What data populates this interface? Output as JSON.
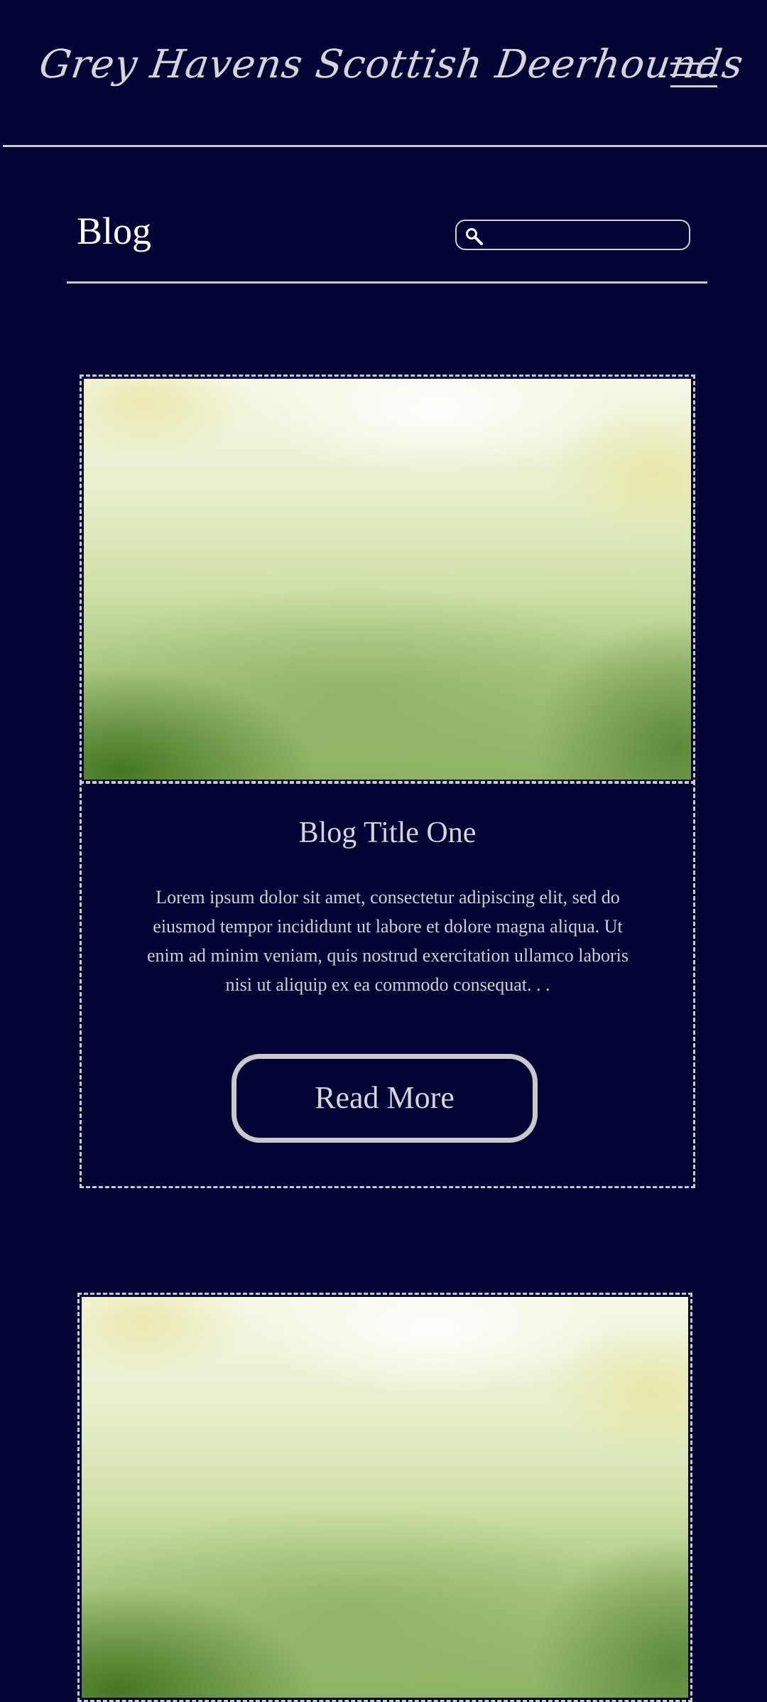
{
  "header": {
    "site_title": "Grey Havens Scottish Deerhounds",
    "menu_icon": "hamburger-menu-icon"
  },
  "blog_bar": {
    "heading": "Blog",
    "search_icon": "search-icon",
    "search_placeholder": "",
    "search_value": ""
  },
  "posts": [
    {
      "title": "Blog Title One",
      "excerpt": "Lorem ipsum dolor sit amet, consectetur adipiscing elit, sed do eiusmod tempor incididunt ut labore et dolore magna aliqua. Ut enim ad minim veniam, quis nostrud exercitation ullamco laboris nisi ut aliquip ex ea commodo consequat. . .",
      "read_more_label": "Read More"
    }
  ],
  "colors": {
    "background": "#010333",
    "text": "#d4d4dc",
    "border": "#c8c8cf",
    "image_light": "#f6f8e6",
    "image_dark": "#467624"
  }
}
